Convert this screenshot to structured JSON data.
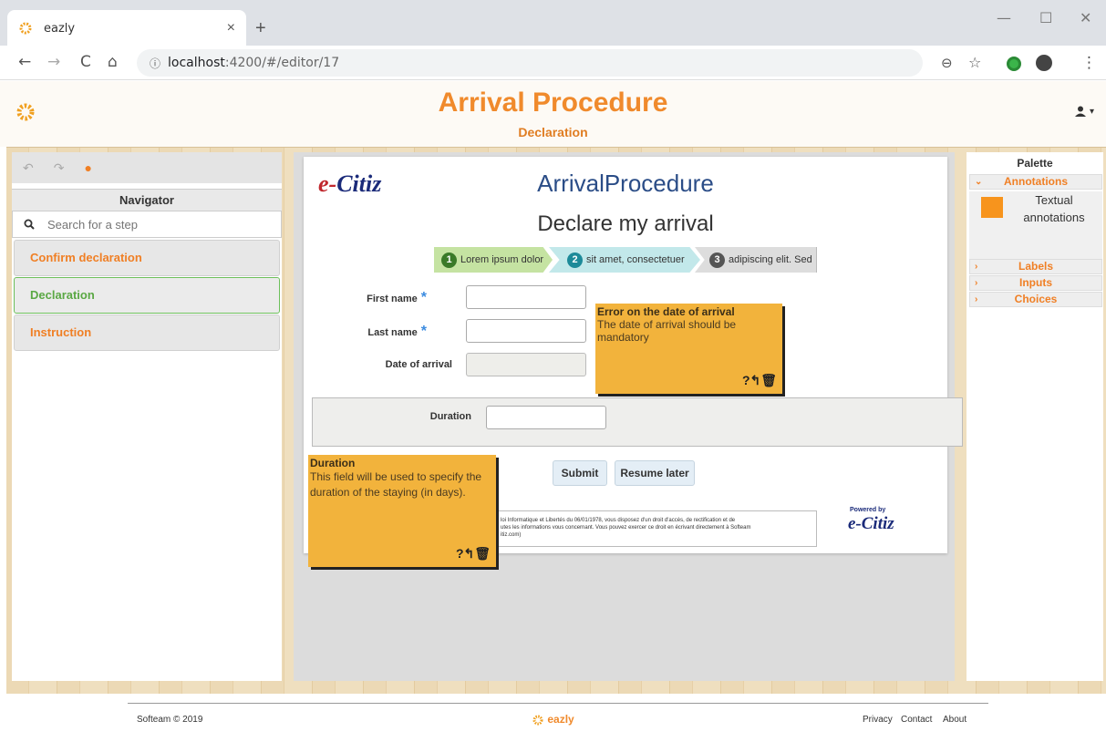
{
  "browser": {
    "tab_title": "eazly",
    "tab_close": "×",
    "new_tab": "+",
    "url_host": "localhost",
    "url_path": ":4200/#/editor/17",
    "info_glyph": "ⓘ",
    "back": "←",
    "forward": "→",
    "reload": "C",
    "home": "⌂",
    "zoom": "⊖",
    "star": "☆",
    "menu": "⋮",
    "minimize": "—",
    "maximize": "☐",
    "close": "✕"
  },
  "header": {
    "title": "Arrival Procedure",
    "subtitle": "Declaration",
    "user_menu": "▾"
  },
  "toolbar": {
    "undo": "↶",
    "redo": "↷",
    "comment": "●"
  },
  "navigator": {
    "title": "Navigator",
    "search_placeholder": "Search for a step",
    "items": [
      {
        "label": "Confirm declaration",
        "active": false
      },
      {
        "label": "Declaration",
        "active": true
      },
      {
        "label": "Instruction",
        "active": false
      }
    ]
  },
  "form": {
    "logo_e": "e-",
    "logo_citiz": "Citiz",
    "procedure_title": "ArrivalProcedure",
    "heading": "Declare my arrival",
    "steps": [
      {
        "num": "1",
        "label": "Lorem ipsum dolor"
      },
      {
        "num": "2",
        "label": "sit amet, consectetuer"
      },
      {
        "num": "3",
        "label": "adipiscing elit. Sed"
      }
    ],
    "fields": {
      "first_name": "First name",
      "last_name": "Last name",
      "date_of_arrival": "Date of arrival",
      "duration": "Duration",
      "required_mark": "*"
    },
    "submit": "Submit",
    "resume_later": "Resume later",
    "legal_line1": "loi Informatique et Libertés du 06/01/1978, vous disposez d'un droit d'accès, de rectification et de",
    "legal_line2": "utes les informations vous concernant. Vous pouvez exercer ce droit en écrivant directement à Softeam",
    "legal_line3": "itiz.com)",
    "powered_by": "Powered by",
    "powered_logo": "e-Citiz"
  },
  "annotations": [
    {
      "title": "Error on the date of arrival",
      "text": "The date of arrival should be mandatory",
      "tools": "?↰🗑"
    },
    {
      "title": "Duration",
      "text": "This field will be used to specify the duration of the staying (in days).",
      "tools": "?↰🗑"
    }
  ],
  "palette": {
    "title": "Palette",
    "sections": [
      {
        "label": "Annotations",
        "chevron": "⌄"
      },
      {
        "label": "Labels",
        "chevron": "›"
      },
      {
        "label": "Inputs",
        "chevron": "›"
      },
      {
        "label": "Choices",
        "chevron": "›"
      }
    ],
    "item_label": "Textual annotations"
  },
  "footer": {
    "copyright": "Softeam © 2019",
    "brand": "eazly",
    "privacy": "Privacy",
    "contact": "Contact",
    "about": "About"
  },
  "colors": {
    "accent": "#f08a2c",
    "active": "#5aa844",
    "note": "#f2b33c"
  }
}
